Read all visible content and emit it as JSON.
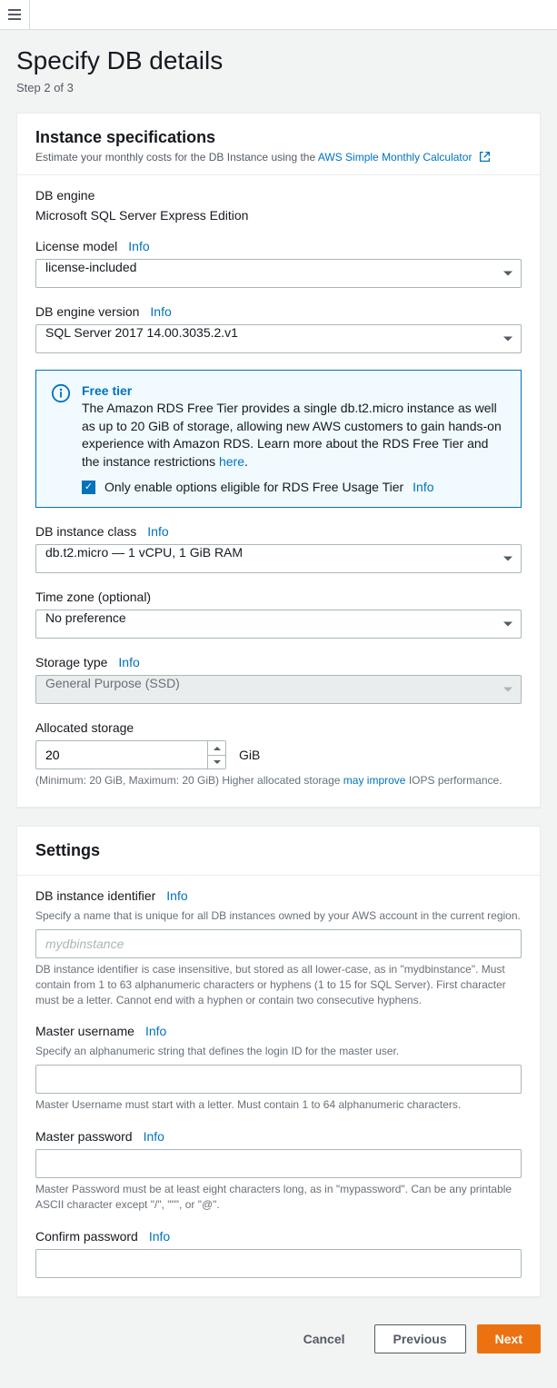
{
  "header": {
    "title": "Specify DB details",
    "step": "Step 2 of 3"
  },
  "instance_spec": {
    "title": "Instance specifications",
    "subtext": "Estimate your monthly costs for the DB Instance using the ",
    "calc_link": "AWS Simple Monthly Calculator",
    "db_engine_label": "DB engine",
    "db_engine_value": "Microsoft SQL Server Express Edition",
    "license_label": "License model",
    "license_value": "license-included",
    "version_label": "DB engine version",
    "version_value": "SQL Server 2017 14.00.3035.2.v1",
    "free_tier": {
      "title": "Free tier",
      "text1": "The Amazon RDS Free Tier provides a single db.t2.micro instance as well as up to 20 GiB of storage, allowing new AWS customers to gain hands-on experience with Amazon RDS. Learn more about the RDS Free Tier and the instance restrictions ",
      "here": "here",
      "checkbox_label": "Only enable options eligible for RDS Free Usage Tier"
    },
    "instance_class_label": "DB instance class",
    "instance_class_value": "db.t2.micro — 1 vCPU, 1 GiB RAM",
    "timezone_label": "Time zone (optional)",
    "timezone_value": "No preference",
    "storage_type_label": "Storage type",
    "storage_type_value": "General Purpose (SSD)",
    "allocated_label": "Allocated storage",
    "allocated_value": "20",
    "allocated_unit": "GiB",
    "allocated_help1": "(Minimum: 20 GiB, Maximum: 20 GiB) Higher allocated storage ",
    "allocated_link": "may improve",
    "allocated_help2": " IOPS performance."
  },
  "settings": {
    "title": "Settings",
    "identifier_label": "DB instance identifier",
    "identifier_desc": "Specify a name that is unique for all DB instances owned by your AWS account in the current region.",
    "identifier_placeholder": "mydbinstance",
    "identifier_help": "DB instance identifier is case insensitive, but stored as all lower-case, as in \"mydbinstance\". Must contain from 1 to 63 alphanumeric characters or hyphens (1 to 15 for SQL Server). First character must be a letter. Cannot end with a hyphen or contain two consecutive hyphens.",
    "username_label": "Master username",
    "username_desc": "Specify an alphanumeric string that defines the login ID for the master user.",
    "username_help": "Master Username must start with a letter. Must contain 1 to 64 alphanumeric characters.",
    "password_label": "Master password",
    "password_help": "Master Password must be at least eight characters long, as in \"mypassword\". Can be any printable ASCII character except \"/\", \"\"\", or \"@\".",
    "confirm_label": "Confirm password"
  },
  "info_label": "Info",
  "footer": {
    "cancel": "Cancel",
    "previous": "Previous",
    "next": "Next"
  }
}
